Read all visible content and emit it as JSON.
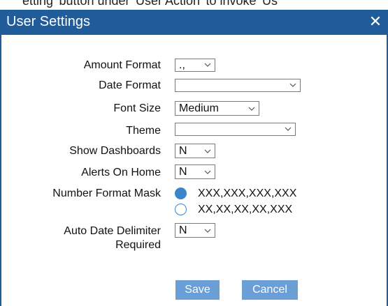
{
  "background": {
    "partial_text": "etting' button under 'User Action' to invoke 'Us"
  },
  "dialog": {
    "title": "User Settings",
    "close_glyph": "✕",
    "accent_color": "#1f5c99",
    "button_color": "#6a9ed6"
  },
  "fields": {
    "amount_format": {
      "label": "Amount Format",
      "value": ".,"
    },
    "date_format": {
      "label": "Date Format",
      "value": ""
    },
    "font_size": {
      "label": "Font Size",
      "value": "Medium"
    },
    "theme": {
      "label": "Theme",
      "value": ""
    },
    "show_dashboards": {
      "label": "Show Dashboards",
      "value": "N"
    },
    "alerts_on_home": {
      "label": "Alerts On Home",
      "value": "N"
    },
    "number_format_mask": {
      "label": "Number Format Mask",
      "options": [
        {
          "text": "XXX,XXX,XXX,XXX",
          "selected": true
        },
        {
          "text": "XX,XX,XX,XX,XXX",
          "selected": false
        }
      ]
    },
    "auto_date_delimiter": {
      "label_line1": "Auto Date Delimiter",
      "label_line2": "Required",
      "value": "N"
    }
  },
  "buttons": {
    "save": "Save",
    "cancel": "Cancel"
  },
  "icons": {
    "dropdown": "chevron-down-icon",
    "close": "close-icon"
  }
}
